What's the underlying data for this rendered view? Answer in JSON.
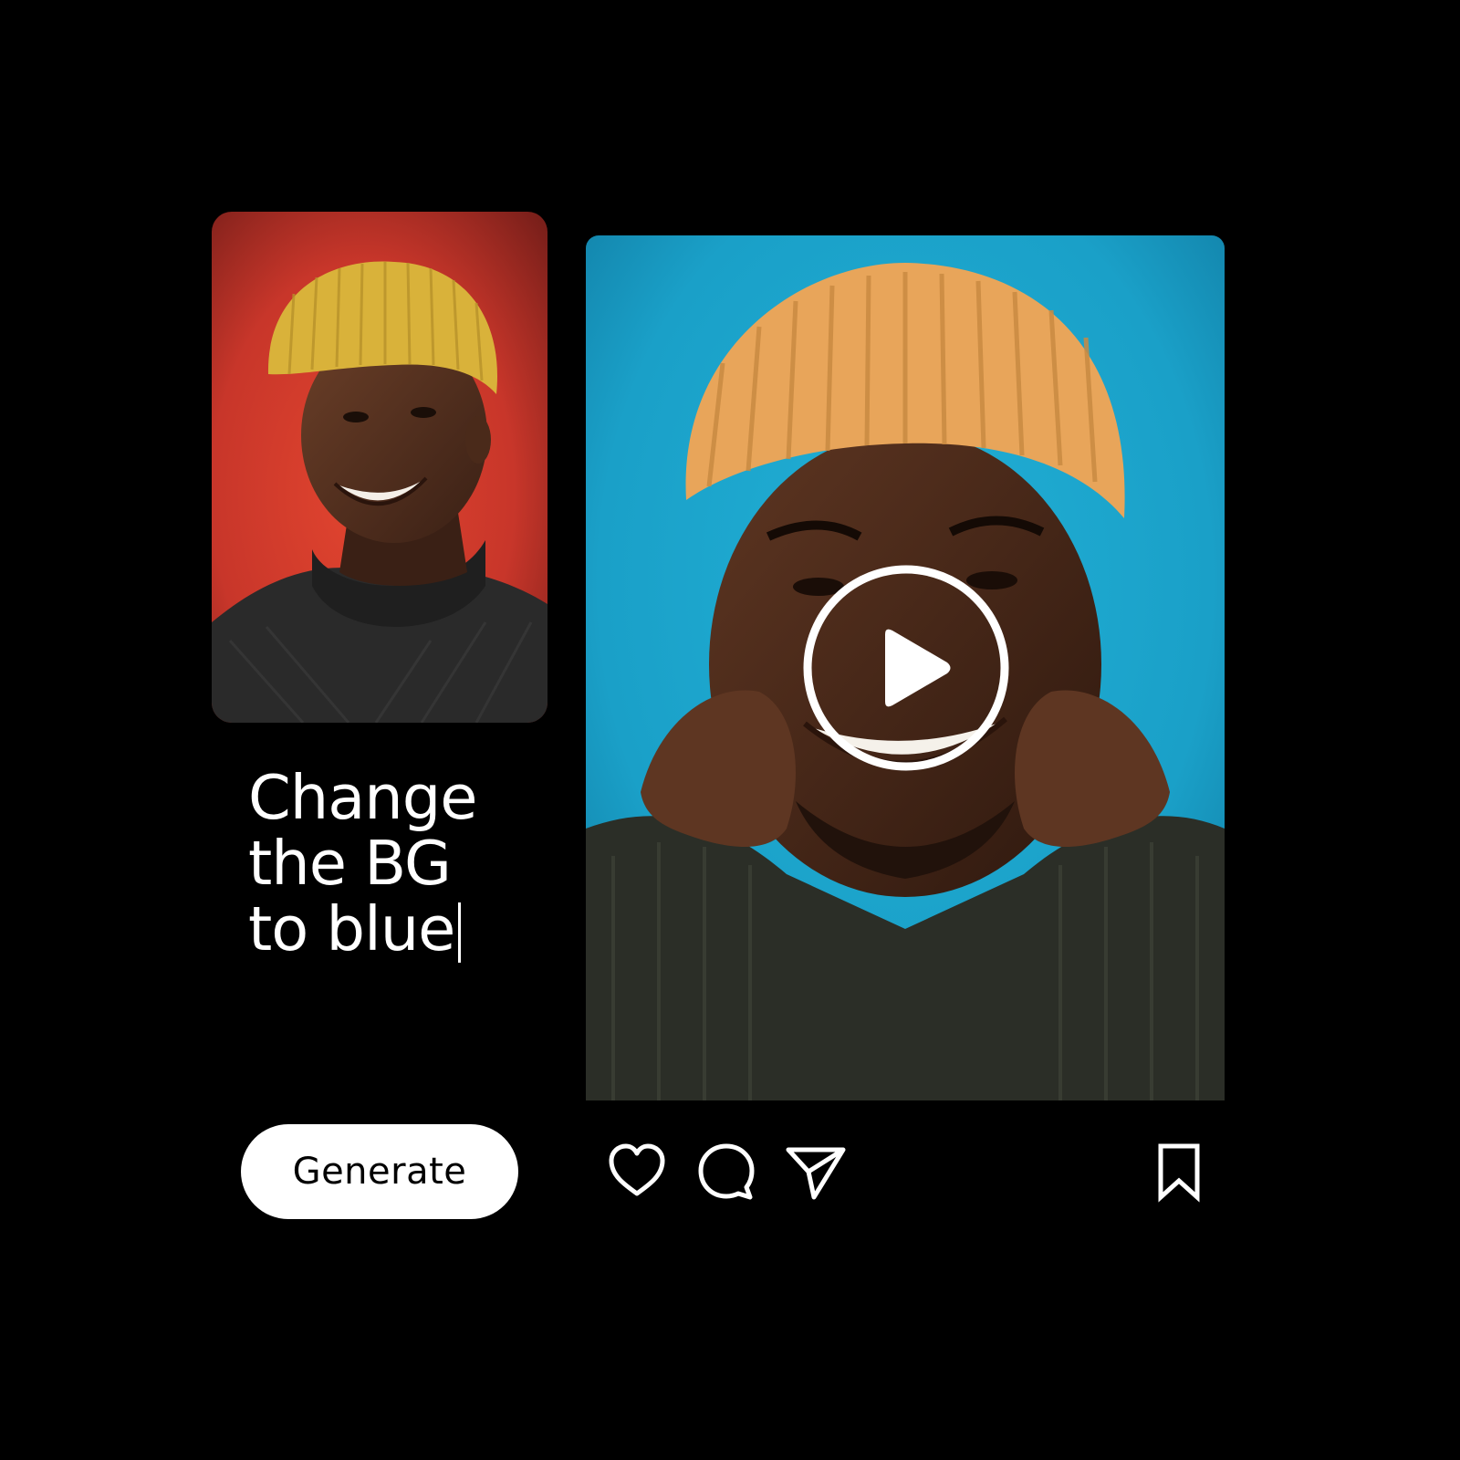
{
  "prompt": {
    "lines": [
      "Change",
      "the BG",
      "to blue"
    ]
  },
  "generate_button": {
    "label": "Generate"
  },
  "source_photo": {
    "background_color": "#c8362a",
    "beanie_color": "#d9b23a",
    "sweater_color": "#2a2a2a"
  },
  "result_video": {
    "background_color": "#1aa0c8",
    "beanie_color": "#e8a55a",
    "sweater_color": "#2b2e27"
  },
  "icons": {
    "play": "play-icon",
    "like": "heart-icon",
    "comment": "comment-bubble-icon",
    "share": "send-icon",
    "bookmark": "bookmark-icon"
  },
  "colors": {
    "page_background": "#000000",
    "text": "#ffffff",
    "button_background": "#ffffff",
    "button_text": "#000000"
  }
}
